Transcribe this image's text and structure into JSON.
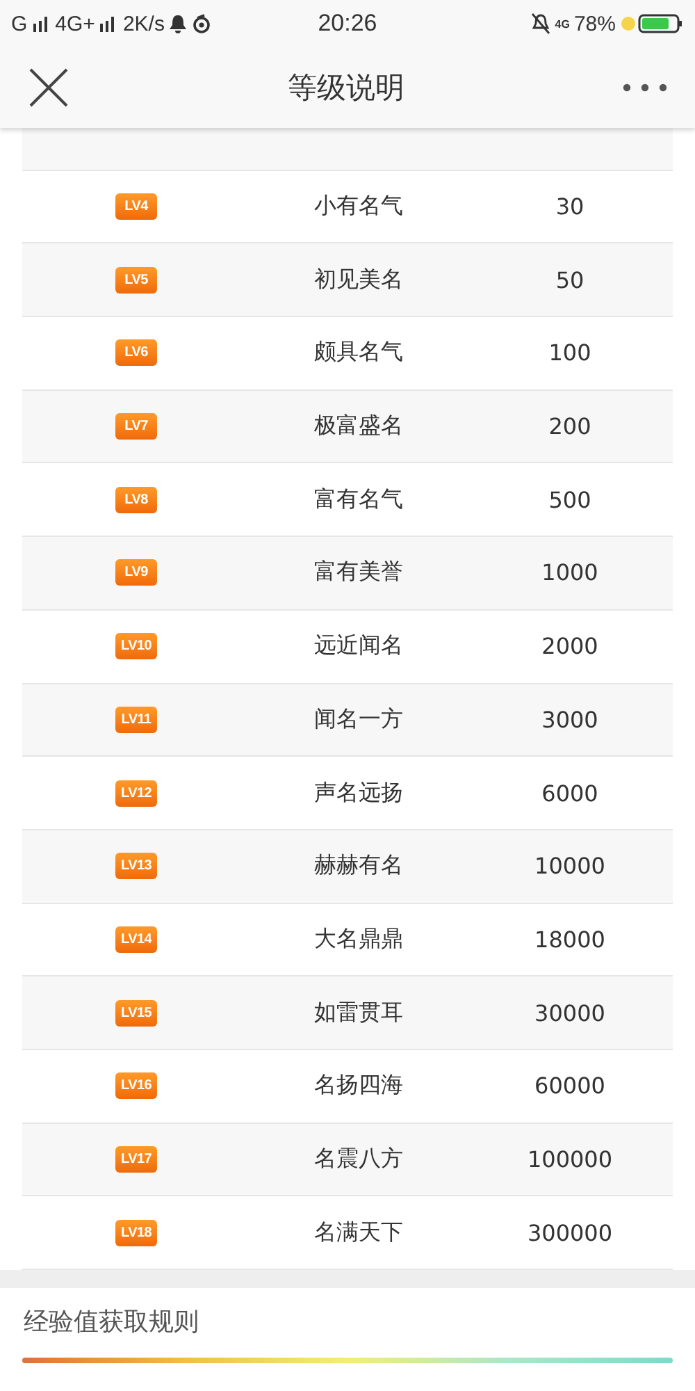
{
  "status_bar": {
    "left": [
      "G",
      "4G+",
      "2K/s"
    ],
    "time": "20:26",
    "network": "4G",
    "battery": "78%"
  },
  "header": {
    "title": "等级说明"
  },
  "levels": [
    {
      "badge": "LV4",
      "name": "小有名气",
      "points": "30"
    },
    {
      "badge": "LV5",
      "name": "初见美名",
      "points": "50"
    },
    {
      "badge": "LV6",
      "name": "颇具名气",
      "points": "100"
    },
    {
      "badge": "LV7",
      "name": "极富盛名",
      "points": "200"
    },
    {
      "badge": "LV8",
      "name": "富有名气",
      "points": "500"
    },
    {
      "badge": "LV9",
      "name": "富有美誉",
      "points": "1000"
    },
    {
      "badge": "LV10",
      "name": "远近闻名",
      "points": "2000"
    },
    {
      "badge": "LV11",
      "name": "闻名一方",
      "points": "3000"
    },
    {
      "badge": "LV12",
      "name": "声名远扬",
      "points": "6000"
    },
    {
      "badge": "LV13",
      "name": "赫赫有名",
      "points": "10000"
    },
    {
      "badge": "LV14",
      "name": "大名鼎鼎",
      "points": "18000"
    },
    {
      "badge": "LV15",
      "name": "如雷贯耳",
      "points": "30000"
    },
    {
      "badge": "LV16",
      "name": "名扬四海",
      "points": "60000"
    },
    {
      "badge": "LV17",
      "name": "名震八方",
      "points": "100000"
    },
    {
      "badge": "LV18",
      "name": "名满天下",
      "points": "300000"
    }
  ],
  "rules": {
    "title": "经验值获取规则"
  }
}
